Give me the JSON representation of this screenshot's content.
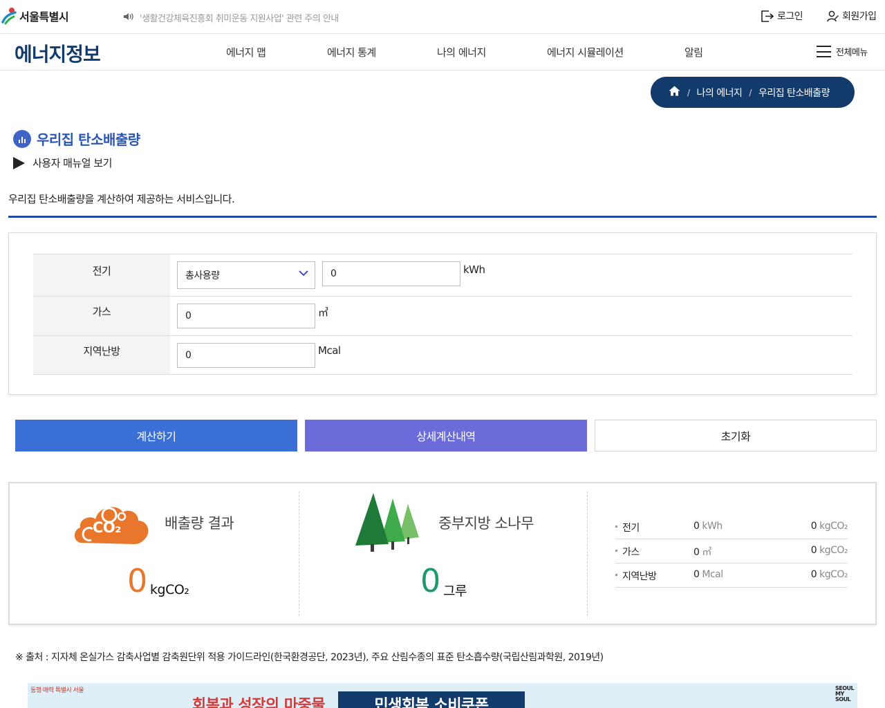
{
  "header": {
    "logo_text": "서울특별시",
    "notice": "'생활건강체육진흥회 취미운동 지원사업' 관련 주의 안내",
    "login": "로그인",
    "signup": "회원가입"
  },
  "gnb": {
    "site_title": "에너지정보",
    "items": [
      "에너지 맵",
      "에너지 통계",
      "나의 에너지",
      "에너지 시뮬레이션",
      "알림"
    ],
    "all_menu": "전체메뉴"
  },
  "breadcrumb": [
    "나의 에너지",
    "우리집 탄소배출량"
  ],
  "page": {
    "title": "우리집 탄소배출량",
    "manual": "사용자 매뉴얼 보기",
    "description": "우리집 탄소배출량을 계산하여 제공하는 서비스입니다."
  },
  "form": {
    "electric": {
      "label": "전기",
      "select_value": "총사용량",
      "value": "0",
      "unit": "kWh"
    },
    "gas": {
      "label": "가스",
      "value": "0",
      "unit": "㎥"
    },
    "district": {
      "label": "지역난방",
      "value": "0",
      "unit": "Mcal"
    }
  },
  "buttons": {
    "calc": "계산하기",
    "detail": "상세계산내역",
    "reset": "초기화"
  },
  "result": {
    "co2_icon_text": "CO₂",
    "emission_label": "배출량 결과",
    "emission_value": "0",
    "emission_unit": "kgCO₂",
    "tree_label": "중부지방 소나무",
    "tree_value": "0",
    "tree_unit": "그루",
    "details": [
      {
        "name": "전기",
        "amount": "0",
        "amount_unit": "kWh",
        "co2": "0",
        "co2_unit": "kgCO₂"
      },
      {
        "name": "가스",
        "amount": "0",
        "amount_unit": "㎥",
        "co2": "0",
        "co2_unit": "kgCO₂"
      },
      {
        "name": "지역난방",
        "amount": "0",
        "amount_unit": "Mcal",
        "co2": "0",
        "co2_unit": "kgCO₂"
      }
    ]
  },
  "source": "※ 출처 : 지자체 온실가스 감축사업별 감축원단위 적용 가이드라인(한국환경공단, 2023년), 주요 산림수종의 표준 탄소흡수량(국립산림과학원, 2019년)",
  "banner": {
    "signature": "동행·매력 특별시 서울",
    "headline": "회복과 성장의 마중물",
    "coupon": "민생회복 소비쿠폰",
    "seal_top": "SEOUL",
    "seal_bottom": "MY SOUL"
  },
  "colors": {
    "navy": "#123a6a",
    "accent_blue": "#3a6fd6",
    "accent_purple": "#6b6bd9",
    "emission_orange": "#e9772b",
    "tree_green": "#1e9a6b"
  }
}
